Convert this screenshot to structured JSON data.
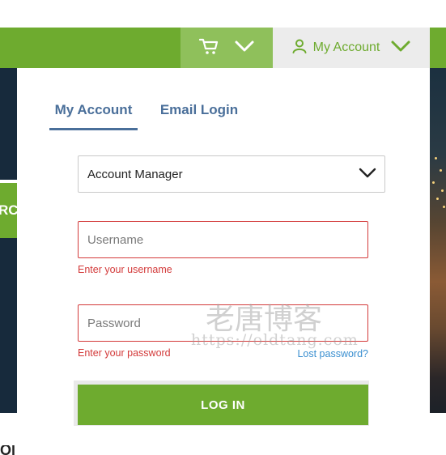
{
  "header": {
    "account_label": "My Account"
  },
  "background": {
    "left_button_fragment": "RC"
  },
  "login_panel": {
    "tabs": [
      {
        "label": "My Account",
        "active": true
      },
      {
        "label": "Email Login",
        "active": false
      }
    ],
    "account_type": {
      "selected": "Account Manager"
    },
    "username": {
      "placeholder": "Username",
      "value": "",
      "error": "Enter your username"
    },
    "password": {
      "placeholder": "Password",
      "value": "",
      "error": "Enter your password"
    },
    "lost_password_label": "Lost password?",
    "login_button_label": "LOG IN"
  },
  "watermark": {
    "chinese": "老唐博客",
    "url": "https://oldtang.com"
  },
  "colors": {
    "brand_green": "#6eab2f",
    "cart_green": "#8fc05b",
    "tab_blue": "#4a6f9a",
    "error_red": "#d33a3a",
    "link_blue": "#3a8fd0"
  },
  "icons": {
    "cart": "cart-icon",
    "cart_chevron": "chevron-down-icon",
    "user": "user-icon",
    "account_chevron": "chevron-down-icon",
    "select_chevron": "chevron-down-icon"
  }
}
